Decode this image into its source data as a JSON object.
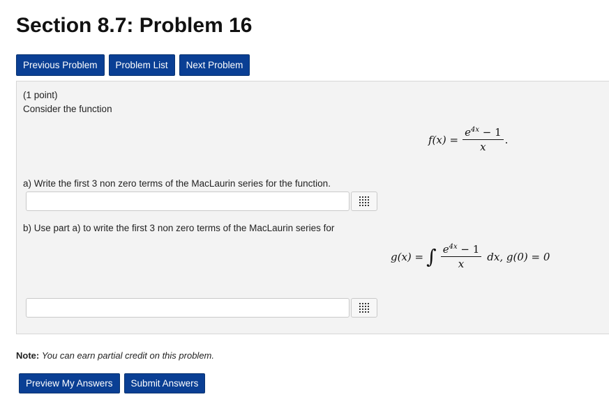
{
  "page": {
    "title": "Section 8.7: Problem 16"
  },
  "nav": {
    "previous": "Previous Problem",
    "list": "Problem List",
    "next": "Next Problem"
  },
  "problem": {
    "points": "(1 point)",
    "intro": "Consider the function",
    "formula_f": {
      "lhs": "f(x) =",
      "num_base": "e",
      "num_exp": "4x",
      "num_tail": " − 1",
      "den": "x",
      "trail": "."
    },
    "part_a": "a) Write the first 3 non zero terms of the MacLaurin series for the function.",
    "part_b": "b) Use part a) to write the first 3 non zero terms of the MacLaurin series for",
    "formula_g": {
      "lhs": "g(x) =",
      "integral": "∫",
      "num_base": "e",
      "num_exp": "4x",
      "num_tail": " − 1",
      "den": "x",
      "tail": "dx,  g(0) = 0"
    },
    "answer_a_value": "",
    "answer_b_value": ""
  },
  "note": {
    "label": "Note:",
    "text": "You can earn partial credit on this problem."
  },
  "actions": {
    "preview": "Preview My Answers",
    "submit": "Submit Answers"
  },
  "icons": {
    "matrix": "matrix-grid-icon"
  },
  "colors": {
    "button": "#0a3f94",
    "panel": "#f3f3f3"
  }
}
